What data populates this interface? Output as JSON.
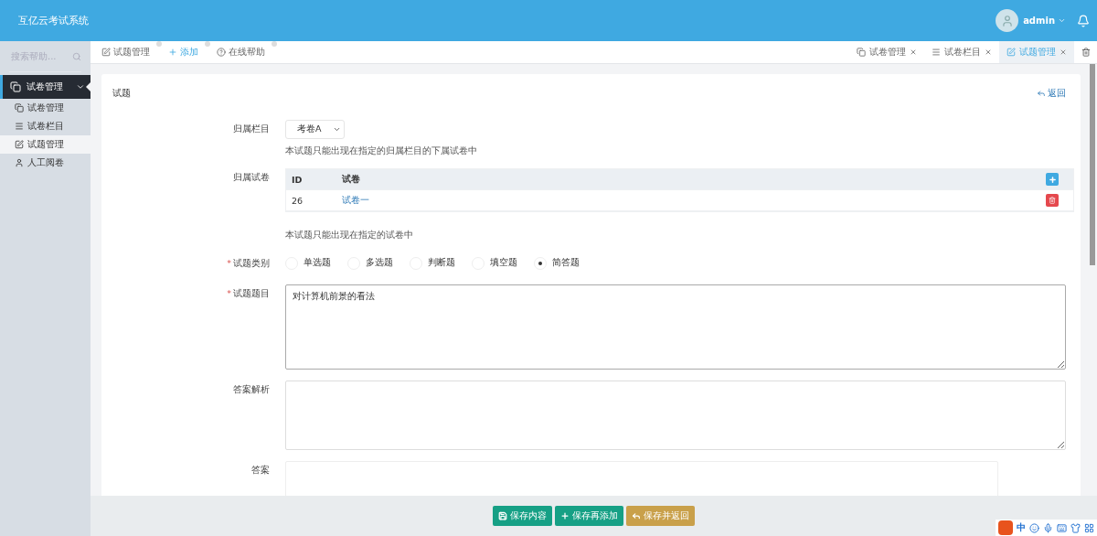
{
  "header": {
    "title": "互亿云考试系统",
    "user": "admin"
  },
  "sidebar": {
    "search_placeholder": "搜索帮助...",
    "group": {
      "label": "试卷管理",
      "expanded": true
    },
    "items": [
      {
        "label": "试卷管理",
        "kind": "copy",
        "selected": false
      },
      {
        "label": "试卷栏目",
        "kind": "list",
        "selected": false
      },
      {
        "label": "试题管理",
        "kind": "edit",
        "selected": true
      },
      {
        "label": "人工阅卷",
        "kind": "user",
        "selected": false
      }
    ]
  },
  "toolbar": [
    {
      "label": "试题管理",
      "kind": "edit"
    },
    {
      "label": "添加",
      "kind": "plus"
    },
    {
      "label": "在线帮助",
      "kind": "help"
    }
  ],
  "tabs": [
    {
      "label": "试卷管理",
      "kind": "copy",
      "selected": false
    },
    {
      "label": "试卷栏目",
      "kind": "list",
      "selected": false
    },
    {
      "label": "试题管理",
      "kind": "edit",
      "selected": true
    }
  ],
  "card": {
    "title": "试题",
    "back": "返回"
  },
  "form": {
    "category": {
      "label": "归属栏目",
      "value": "考卷A",
      "help": "本试题只能出现在指定的归属栏目的下属试卷中"
    },
    "papers": {
      "label": "归属试卷",
      "columns": [
        "ID",
        "试卷"
      ],
      "rows": [
        [
          "26",
          "试卷一"
        ]
      ],
      "help": "本试题只能出现在指定的试卷中"
    },
    "type": {
      "label": "试题类别",
      "required_mark": "*",
      "options": [
        {
          "label": "单选题",
          "selected": false
        },
        {
          "label": "多选题",
          "selected": false
        },
        {
          "label": "判断题",
          "selected": false
        },
        {
          "label": "填空题",
          "selected": false
        },
        {
          "label": "简答题",
          "selected": true
        }
      ]
    },
    "question": {
      "label": "试题题目",
      "required_mark": "*",
      "value": "对计算机前景的看法"
    },
    "analysis": {
      "label": "答案解析"
    },
    "answer": {
      "label": "答案"
    }
  },
  "footer": [
    {
      "label": "保存内容",
      "kind": "save"
    },
    {
      "label": "保存再添加",
      "kind": "add"
    },
    {
      "label": "保存并返回",
      "kind": "back"
    }
  ],
  "ime": {
    "label": "中"
  }
}
